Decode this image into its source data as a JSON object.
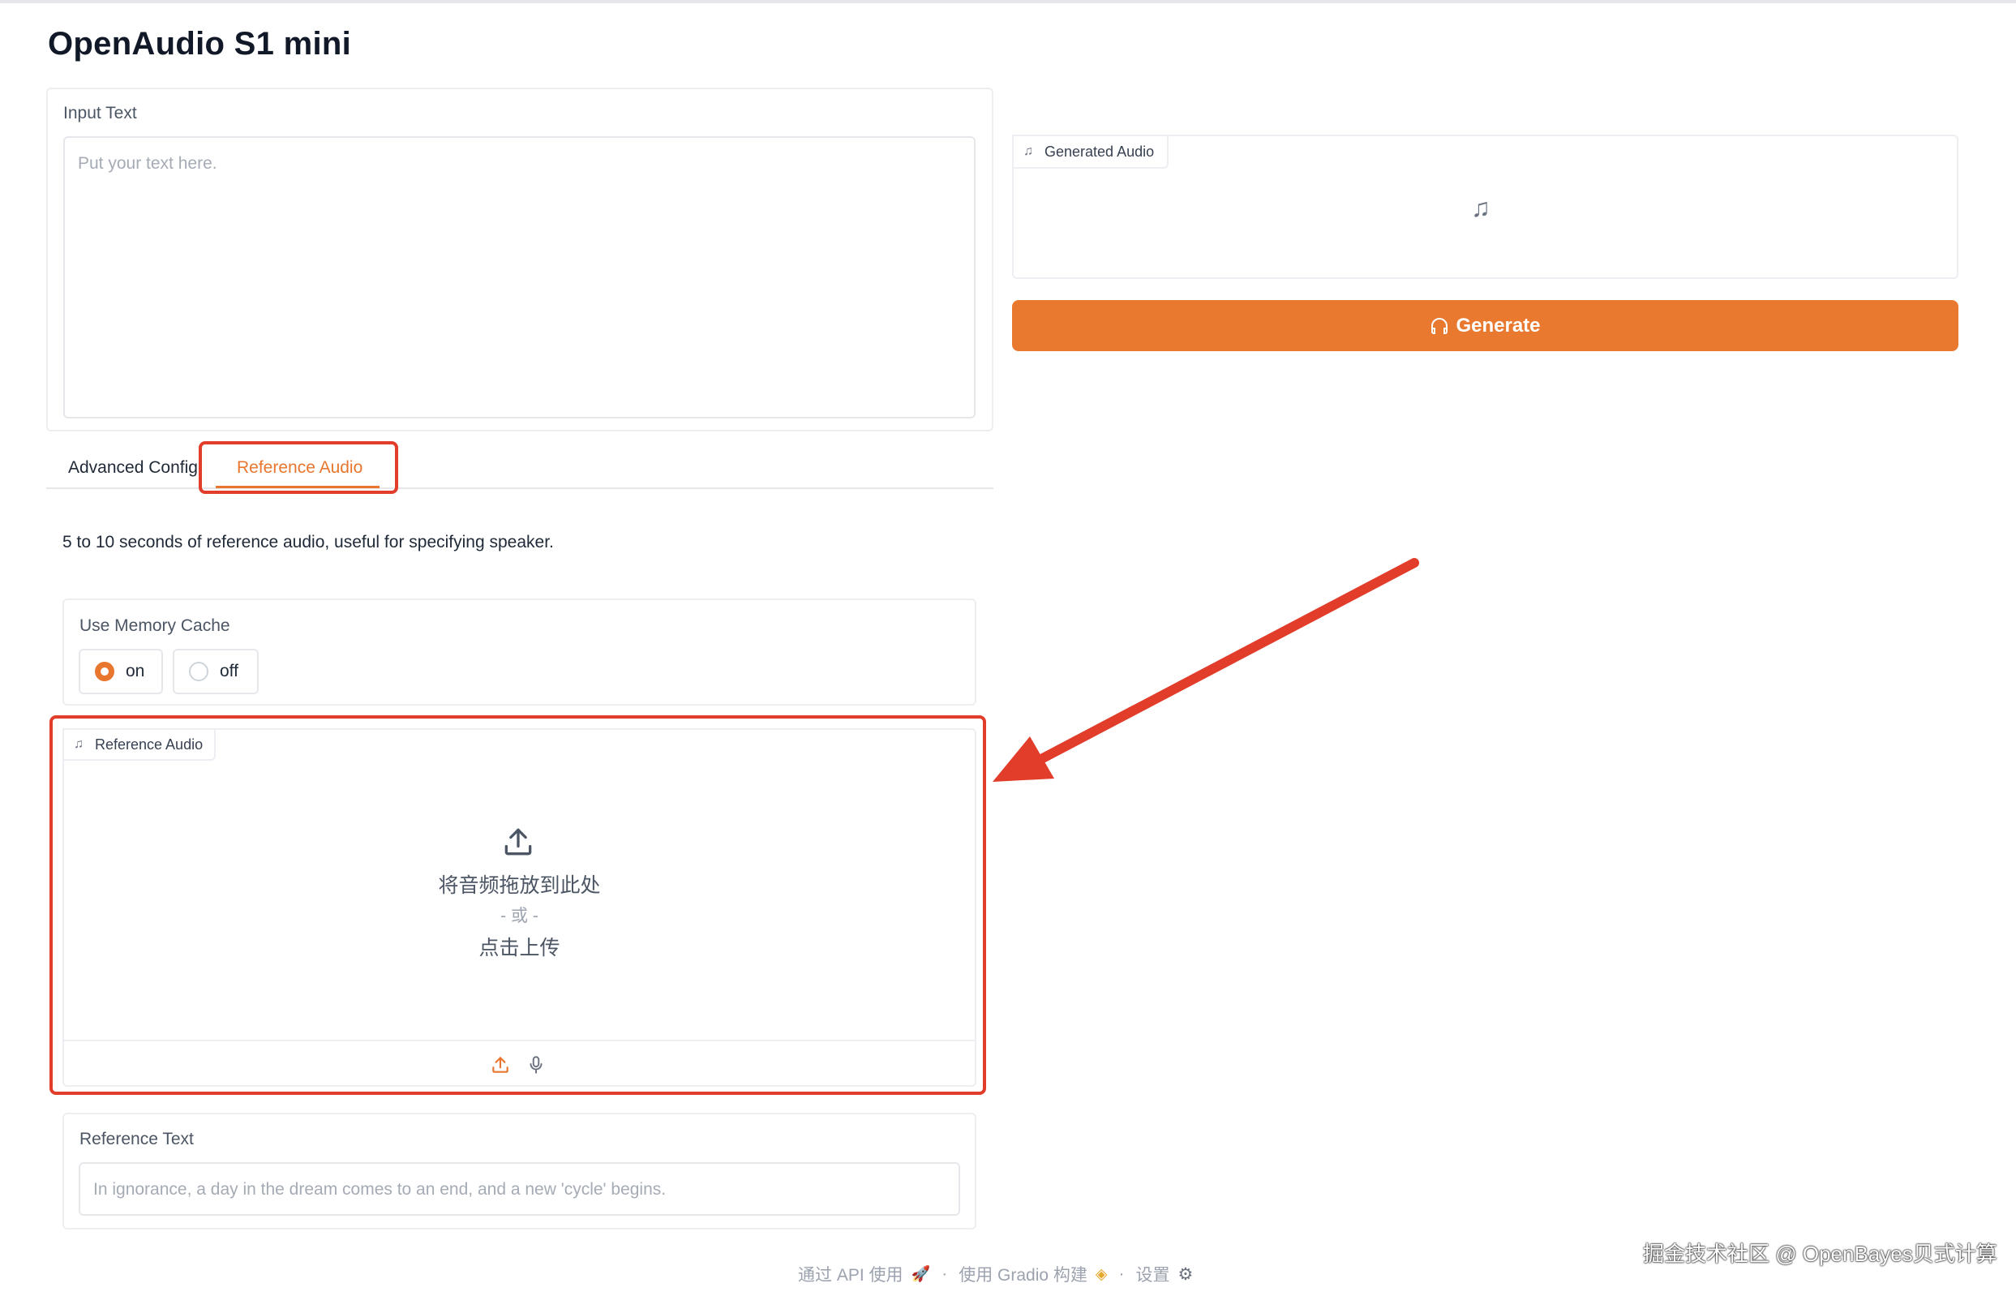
{
  "app": {
    "title": "OpenAudio S1 mini"
  },
  "input_text": {
    "label": "Input Text",
    "placeholder": "Put your text here."
  },
  "tabs": [
    {
      "label": "Advanced Config",
      "active": false
    },
    {
      "label": "Reference Audio",
      "active": true
    }
  ],
  "reference_tab": {
    "description": "5 to 10 seconds of reference audio, useful for specifying speaker.",
    "memory_cache": {
      "label": "Use Memory Cache",
      "options": [
        "on",
        "off"
      ],
      "selected": "on"
    },
    "reference_audio": {
      "label": "Reference Audio",
      "drop_text": "将音频拖放到此处",
      "or_text": "- 或 -",
      "click_text": "点击上传"
    },
    "reference_text": {
      "label": "Reference Text",
      "placeholder": "In ignorance, a day in the dream comes to an end, and a new 'cycle' begins."
    }
  },
  "output": {
    "generated_audio_label": "Generated Audio",
    "generate_button": "Generate"
  },
  "footer": {
    "api": "通过 API 使用",
    "built_with": "使用 Gradio 构建",
    "settings": "设置"
  },
  "watermark": "掘金技术社区 @ OpenBayes贝式计算",
  "colors": {
    "accent": "#e8762f",
    "annotation": "#e23c2a"
  },
  "icons": [
    "music-note-icon",
    "headphones-icon",
    "upload-icon",
    "microphone-icon",
    "rocket-icon",
    "gradio-logo-icon",
    "gear-icon"
  ]
}
